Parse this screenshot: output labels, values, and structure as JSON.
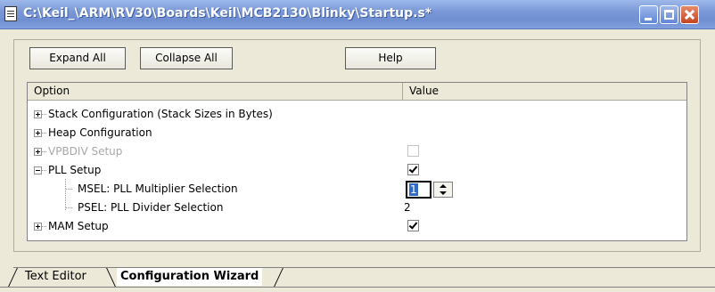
{
  "window": {
    "title": "C:\\Keil_\\ARM\\RV30\\Boards\\Keil\\MCB2130\\Blinky\\Startup.s*"
  },
  "toolbar": {
    "expand_all": "Expand All",
    "collapse_all": "Collapse All",
    "help": "Help"
  },
  "table": {
    "columns": [
      "Option",
      "Value"
    ],
    "rows": [
      {
        "label": "Stack Configuration (Stack Sizes in Bytes)",
        "expander": "plus",
        "level": 0,
        "value_type": "none"
      },
      {
        "label": "Heap Configuration",
        "expander": "plus",
        "level": 0,
        "value_type": "none"
      },
      {
        "label": "VPBDIV Setup",
        "expander": "plus",
        "level": 0,
        "disabled": true,
        "value_type": "checkbox",
        "checked": false
      },
      {
        "label": "PLL Setup",
        "expander": "minus",
        "level": 0,
        "value_type": "checkbox",
        "checked": true
      },
      {
        "label": "MSEL: PLL Multiplier Selection",
        "level": 1,
        "value_type": "spinner",
        "value": "1"
      },
      {
        "label": "PSEL: PLL Divider Selection",
        "level": 1,
        "value_type": "text",
        "value": "2"
      },
      {
        "label": "MAM Setup",
        "expander": "plus",
        "level": 0,
        "value_type": "checkbox",
        "checked": true
      }
    ]
  },
  "tabs": [
    {
      "label": "Text Editor",
      "active": false
    },
    {
      "label": "Configuration Wizard",
      "active": true
    }
  ],
  "icons": {
    "document": "document-icon",
    "minimize": "minimize-icon",
    "maximize": "maximize-icon",
    "close": "close-icon"
  },
  "colors": {
    "titlebar": "#7a98d6",
    "close_button": "#c4441f",
    "selection": "#316ac5",
    "disabled_text": "#a8a8a8"
  }
}
